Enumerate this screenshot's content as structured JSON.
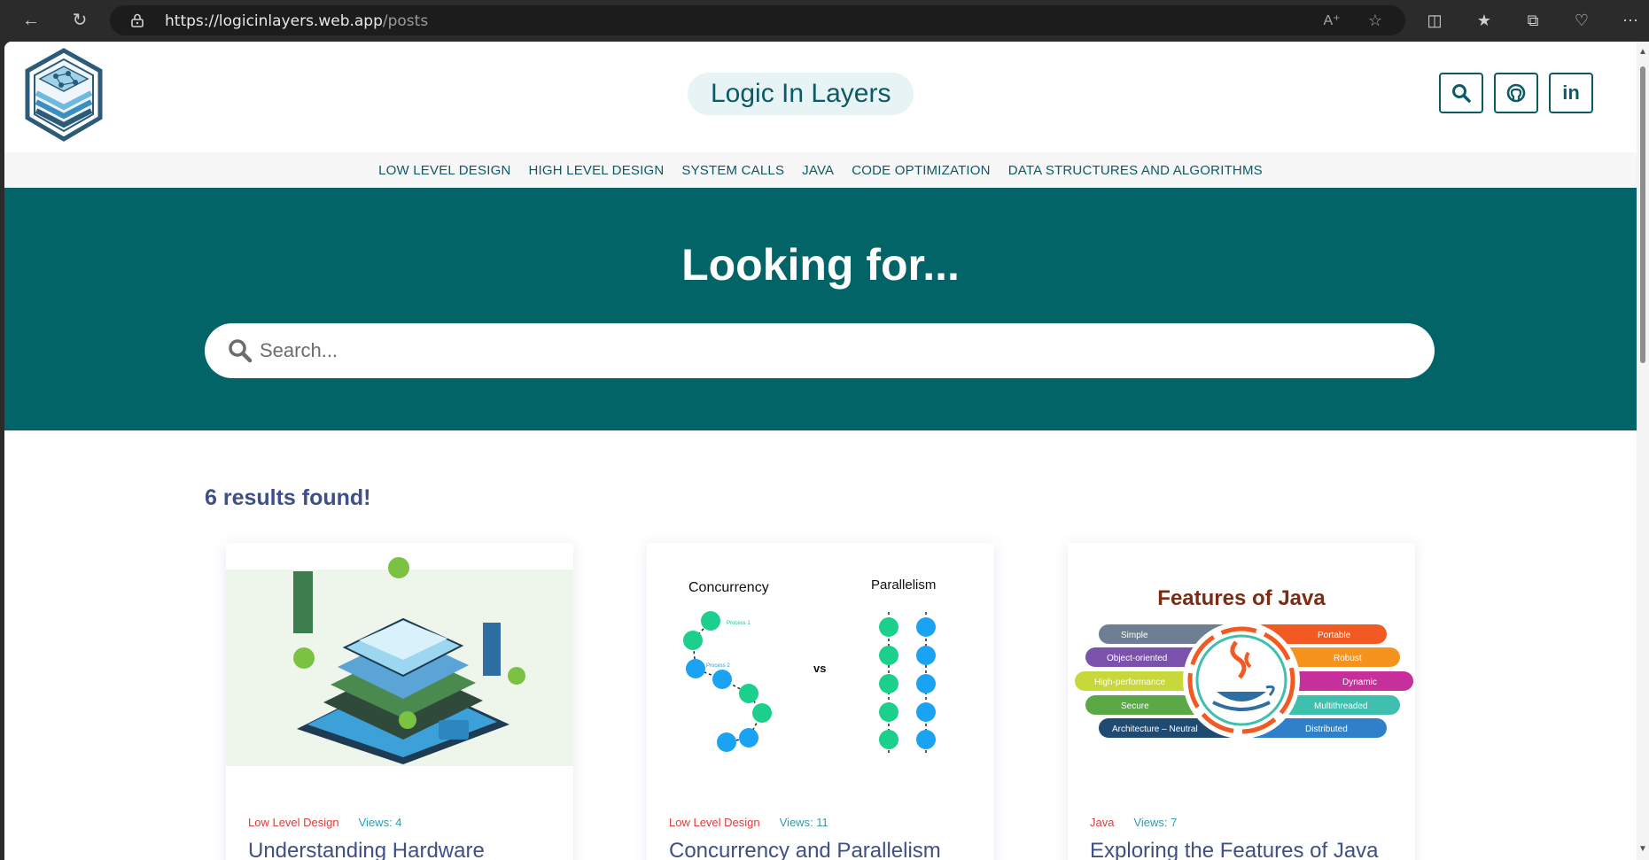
{
  "browser": {
    "url_host": "https://logicinlayers.web.app",
    "url_path": "/posts"
  },
  "site": {
    "brand": "Logic In Layers"
  },
  "nav": {
    "items": [
      "LOW LEVEL DESIGN",
      "HIGH LEVEL DESIGN",
      "SYSTEM CALLS",
      "JAVA",
      "CODE OPTIMIZATION",
      "DATA STRUCTURES AND ALGORITHMS"
    ]
  },
  "hero": {
    "title": "Looking for...",
    "search_placeholder": "Search..."
  },
  "results": {
    "text": "6 results found!"
  },
  "cards": [
    {
      "category": "Low Level Design",
      "views": "Views: 4",
      "title": "Understanding Hardware"
    },
    {
      "category": "Low Level Design",
      "views": "Views: 11",
      "title": "Concurrency and Parallelism",
      "img_left": "Concurrency",
      "img_right": "Parallelism",
      "img_vs": "vs",
      "img_p1": "Process 1",
      "img_p2": "Process 2"
    },
    {
      "category": "Java",
      "views": "Views: 7",
      "title": "Exploring the Features of Java",
      "img_title": "Features of Java",
      "features_left": [
        "Simple",
        "Object-oriented",
        "High-performance",
        "Secure",
        "Architecture – Neutral"
      ],
      "features_right": [
        "Portable",
        "Robust",
        "Dynamic",
        "Multithreaded",
        "Distributed"
      ]
    }
  ],
  "colors": {
    "primary": "#036467",
    "accent_text": "#0c5a64",
    "category_red": "#e03b3b",
    "views_teal": "#2d9ea8",
    "title_indigo": "#3f4f87"
  }
}
